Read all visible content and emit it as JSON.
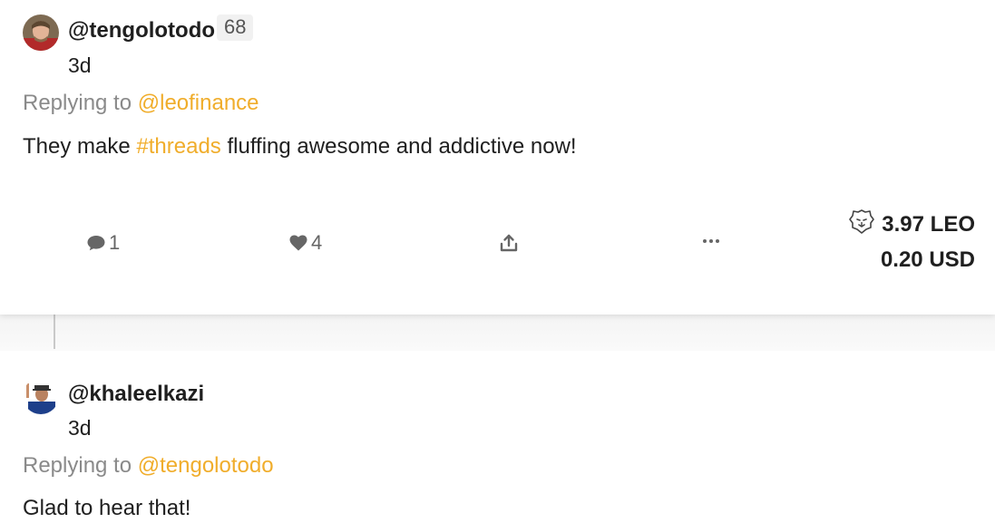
{
  "posts": [
    {
      "author": "@tengolotodo",
      "reputation": "68",
      "time": "3d",
      "replying_prefix": "Replying to",
      "replying_to": "@leofinance",
      "body_before": "They make ",
      "hashtag": "#threads",
      "body_after": " fluffing awesome and addictive now!",
      "actions": {
        "comments": "1",
        "likes": "4"
      },
      "reward": {
        "leo": "3.97 LEO",
        "usd": "0.20 USD"
      }
    },
    {
      "author": "@khaleelkazi",
      "time": "3d",
      "replying_prefix": "Replying to",
      "replying_to": "@tengolotodo",
      "body": "Glad to hear that!"
    }
  ],
  "colors": {
    "accent": "#f0ad2b",
    "muted_text": "#8a8a8a",
    "icon": "#666666"
  },
  "icons": {
    "comment": "speech-bubble-icon",
    "like": "heart-icon",
    "share": "share-upload-icon",
    "more": "ellipsis-icon",
    "token": "lion-icon"
  }
}
